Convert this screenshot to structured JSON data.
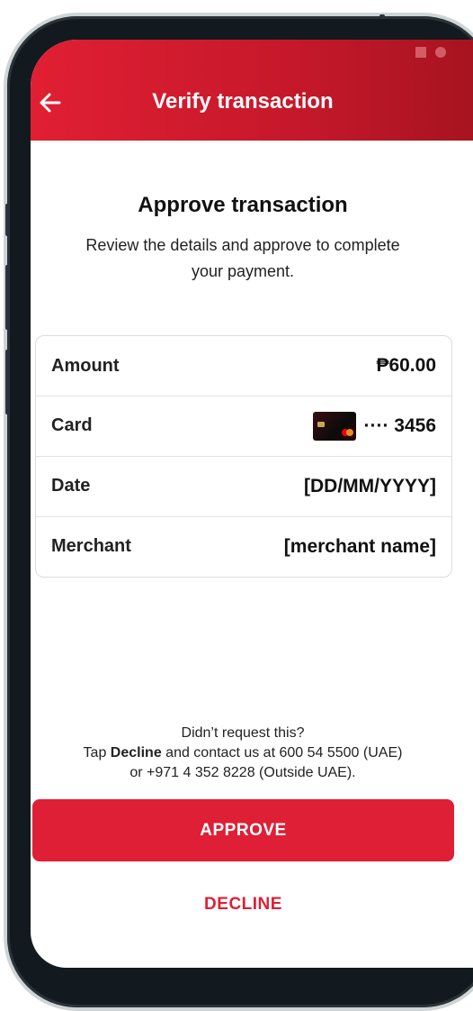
{
  "header": {
    "title": "Verify transaction",
    "back_icon": "arrow-left-icon",
    "color": "#e11f33"
  },
  "main": {
    "heading": "Approve transaction",
    "subtitle": "Review the details and approve to complete your payment."
  },
  "details": {
    "amount_label": "Amount",
    "amount_value": "₱60.00",
    "card_label": "Card",
    "card_value": "···· 3456",
    "card_icon": "credit-card-icon",
    "date_label": "Date",
    "date_value": "[DD/MM/YYYY]",
    "merchant_label": "Merchant",
    "merchant_value": "[merchant name]"
  },
  "help": {
    "line1": "Didn’t request this?",
    "line2_pre": "Tap ",
    "line2_bold": "Decline",
    "line2_post": " and contact us at 600 54 5500 (UAE)",
    "line3": "or +971 4 352 8228 (Outside UAE)."
  },
  "actions": {
    "approve_label": "APPROVE",
    "decline_label": "DECLINE",
    "accent": "#df1f35"
  }
}
